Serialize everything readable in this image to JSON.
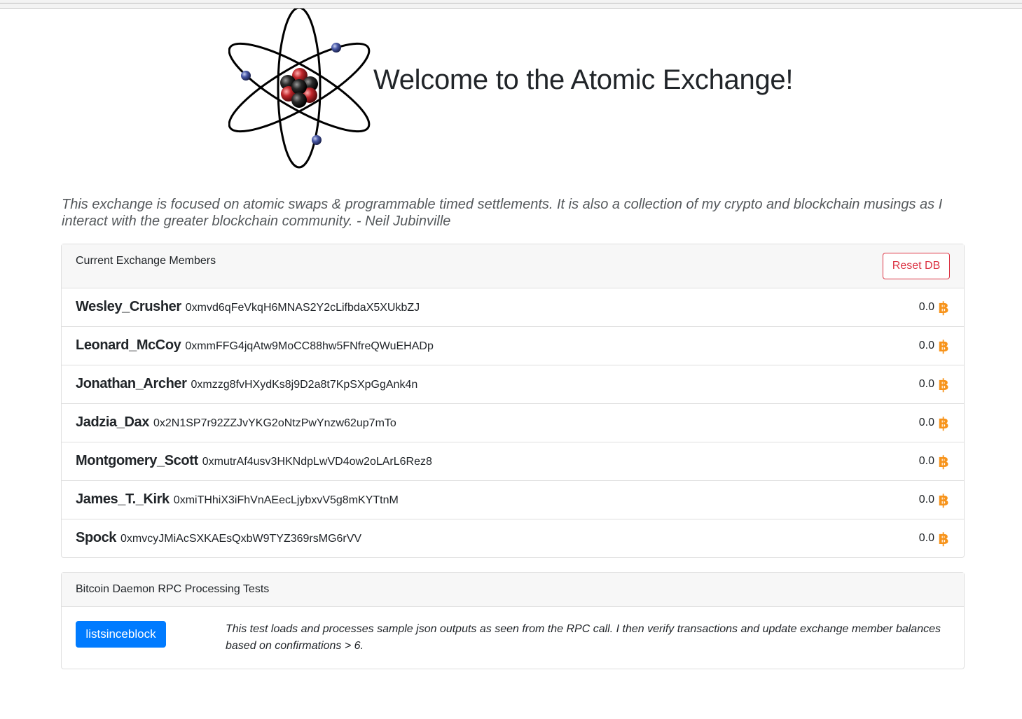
{
  "header": {
    "title": "Welcome to the Atomic Exchange!",
    "logo_icon": "atom-icon"
  },
  "intro": {
    "text": "This exchange is focused on atomic swaps & programmable timed settlements. It is also a collection of my crypto and blockchain musings as I interact with the greater blockchain community. - Neil Jubinville"
  },
  "members_card": {
    "title": "Current Exchange Members",
    "reset_label": "Reset DB",
    "currency_icon": "bitcoin-icon",
    "bitcoin_color": "#f7931a",
    "members": [
      {
        "name": "Wesley_Crusher",
        "address": "0xmvd6qFeVkqH6MNAS2Y2cLifbdaX5XUkbZJ",
        "balance": "0.0"
      },
      {
        "name": "Leonard_McCoy",
        "address": "0xmmFFG4jqAtw9MoCC88hw5FNfreQWuEHADp",
        "balance": "0.0"
      },
      {
        "name": "Jonathan_Archer",
        "address": "0xmzzg8fvHXydKs8j9D2a8t7KpSXpGgAnk4n",
        "balance": "0.0"
      },
      {
        "name": "Jadzia_Dax",
        "address": "0x2N1SP7r92ZZJvYKG2oNtzPwYnzw62up7mTo",
        "balance": "0.0"
      },
      {
        "name": "Montgomery_Scott",
        "address": "0xmutrAf4usv3HKNdpLwVD4ow2oLArL6Rez8",
        "balance": "0.0"
      },
      {
        "name": "James_T._Kirk",
        "address": "0xmiTHhiX3iFhVnAEecLjybxvV5g8mKYTtnM",
        "balance": "0.0"
      },
      {
        "name": "Spock",
        "address": "0xmvcyJMiAcSXKAEsQxbW9TYZ369rsMG6rVV",
        "balance": "0.0"
      }
    ]
  },
  "rpc_card": {
    "title": "Bitcoin Daemon RPC Processing Tests",
    "button_label": "listsinceblock",
    "description": "This test loads and processes sample json outputs as seen from the RPC call. I then verify transactions and update exchange member balances based on confirmations > 6.",
    "button_color": "#007bff"
  }
}
